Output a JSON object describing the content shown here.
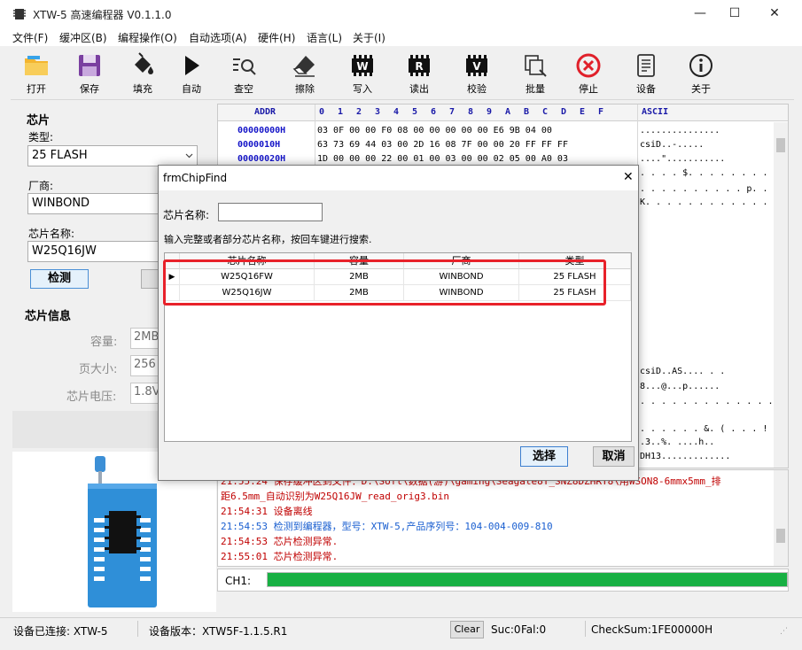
{
  "window": {
    "title": "XTW-5 高速编程器  V0.1.1.0",
    "minimize": "—",
    "maximize": "☐",
    "close": "✕"
  },
  "menu": [
    "文件(F)",
    "缓冲区(B)",
    "编程操作(O)",
    "自动选项(A)",
    "硬件(H)",
    "语言(L)",
    "关于(I)"
  ],
  "toolbar": [
    {
      "label": "打开",
      "icon": "folder-open-icon"
    },
    {
      "label": "保存",
      "icon": "floppy-disk-icon"
    },
    {
      "label": "填充",
      "icon": "paint-bucket-icon"
    },
    {
      "label": "自动",
      "icon": "play-icon"
    },
    {
      "label": "查空",
      "icon": "search-blank-icon"
    },
    {
      "label": "擦除",
      "icon": "eraser-icon"
    },
    {
      "label": "写入",
      "icon": "write-chip-icon"
    },
    {
      "label": "读出",
      "icon": "read-chip-icon"
    },
    {
      "label": "校验",
      "icon": "verify-chip-icon"
    },
    {
      "label": "批量",
      "icon": "batch-icon"
    },
    {
      "label": "停止",
      "icon": "stop-icon"
    },
    {
      "label": "设备",
      "icon": "device-icon"
    },
    {
      "label": "关于",
      "icon": "info-icon"
    }
  ],
  "chip": {
    "section_title": "芯片",
    "type_label": "类型:",
    "type_value": "25 FLASH",
    "vendor_label": "厂商:",
    "vendor_value": "WINBOND",
    "name_label": "芯片名称:",
    "name_value": "W25Q16JW",
    "detect_button": "检测",
    "info_title": "芯片信息",
    "capacity_label": "容量:",
    "capacity_value": "2MB",
    "page_label": "页大小:",
    "page_value": "256",
    "voltage_label": "芯片电压:",
    "voltage_value": "1.8V"
  },
  "hex": {
    "addr_header": "ADDR",
    "col_headers": [
      "0",
      "1",
      "2",
      "3",
      "4",
      "5",
      "6",
      "7",
      "8",
      "9",
      "A",
      "B",
      "C",
      "D",
      "E",
      "F"
    ],
    "ascii_header": "ASCII",
    "rows": [
      {
        "addr": "00000000H",
        "bytes": "03 0F 00 00 F0 08 00 00 00 00 00 E6 9B 04 00",
        "ascii": "..............."
      },
      {
        "addr": "0000010H",
        "bytes": "63 73 69 44 03 00 2D 16 08 7F 00 00 20 FF FF FF",
        "ascii": "csiD..-....."
      },
      {
        "addr": "00000020H",
        "bytes": "1D 00 00 00 22 00 01 00 03 00 00 02 05 00 A0 03",
        "ascii": "....\"..........."
      }
    ],
    "ascii_fragments": [
      ". . . . $. . . . . . . . . .",
      ". . . . . . . . . . p. . . . .",
      "K. . . . . . . . . . . . . . .",
      "csiD..AS.... . .",
      "8...@...p......",
      ". . . . . . . . . . . . . . . .",
      ". . . . . . &. ( . . . ! . .",
      ".3..%. ....h..",
      "DH13............."
    ]
  },
  "log": [
    {
      "text": "21:55:24  保存缓冲区到文件：D:\\Soft\\数据(游)\\gaming\\Seagate8T_SNZ8DZHRT8\\用WSON8-6mmx5mm_排",
      "color": "#c00000"
    },
    {
      "text": "距6.5mm_自动识别为W25Q16JW_read_orig3.bin",
      "color": "#c00000"
    },
    {
      "text": "21:54:31 设备离线",
      "color": "#c00000"
    },
    {
      "text": "21:54:53 检测到编程器，型号：XTW-5,产品序列号：104-004-009-810",
      "color": "#1a5fd0"
    },
    {
      "text": "21:54:53 芯片检测异常.",
      "color": "#c00000"
    },
    {
      "text": "21:55:01 芯片检测异常.",
      "color": "#c00000"
    }
  ],
  "progress": {
    "label": "CH1:",
    "value": 1.0,
    "color": "#18b043"
  },
  "status": {
    "connected": "设备已连接: XTW-5",
    "version": "设备版本：XTW5F-1.1.5.R1",
    "clear": "Clear",
    "suc": "Suc:0",
    "fal": "Fal:0",
    "checksum": "CheckSum:1FE00000H"
  },
  "dialog": {
    "title": "frmChipFind",
    "search_label": "芯片名称:",
    "search_value": "",
    "hint": "输入完整或者部分芯片名称，按回车键进行搜索.",
    "columns": [
      "芯片名称",
      "容量",
      "厂商",
      "类型"
    ],
    "rows": [
      [
        "W25Q16FW",
        "2MB",
        "WINBOND",
        "25 FLASH"
      ],
      [
        "W25Q16JW",
        "2MB",
        "WINBOND",
        "25 FLASH"
      ]
    ],
    "select_button": "选择",
    "cancel_button": "取消",
    "highlight_color": "#e8212a"
  }
}
